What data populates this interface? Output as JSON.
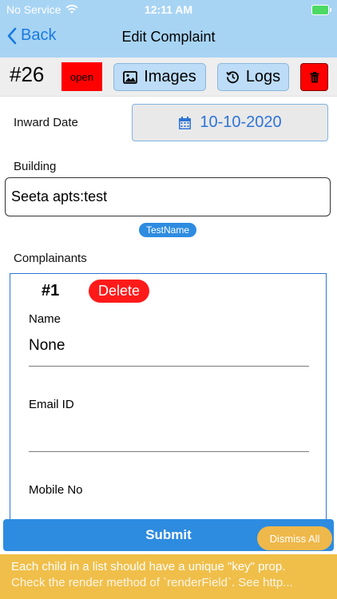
{
  "status_bar": {
    "carrier": "No Service",
    "time": "12:11 AM"
  },
  "nav": {
    "back_label": "Back",
    "title": "Edit Complaint"
  },
  "complaint": {
    "id": "#26",
    "status": "open",
    "images_label": "Images",
    "logs_label": "Logs",
    "icons": {
      "images": "image-icon",
      "logs": "history-icon",
      "delete": "trash-icon"
    }
  },
  "inward": {
    "label": "Inward Date",
    "date": "10-10-2020",
    "icon": "calendar-icon"
  },
  "building": {
    "label": "Building",
    "value": "Seeta apts:test",
    "tag": "TestName"
  },
  "complainants": {
    "label": "Complainants",
    "items": [
      {
        "number": "#1",
        "delete_label": "Delete",
        "name_label": "Name",
        "name_value": "None",
        "email_label": "Email ID",
        "email_value": "",
        "mobile_label": "Mobile No"
      }
    ]
  },
  "submit_label": "Submit",
  "dismiss_label": "Dismiss All",
  "warning": {
    "line1": "Each child in a list should have a unique \"key\" prop.",
    "line2": "Check the render method of `renderField`. See http..."
  },
  "colors": {
    "nav_bg": "#a8d4f4",
    "accent": "#2d8ce0",
    "open_status": "#ff0000",
    "warning_bg": "#f0bf4a"
  }
}
